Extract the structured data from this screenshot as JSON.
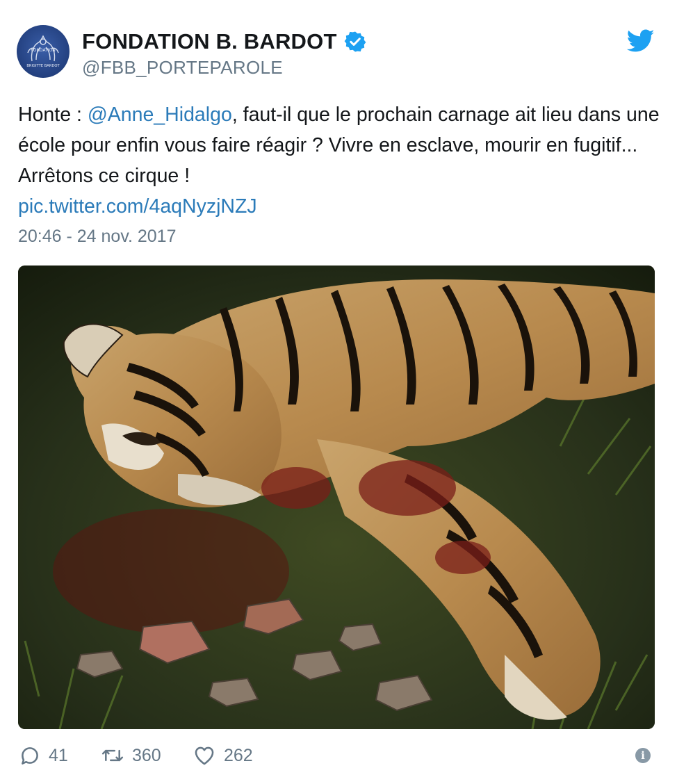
{
  "author": {
    "display_name": "FONDATION B. BARDOT",
    "handle": "@FBB_PORTEPAROLE",
    "verified": true,
    "avatar_icon": "foundation-logo-avatar",
    "avatar_text_top": "FONDATION",
    "avatar_text_bottom": "BRIGITTE BARDOT"
  },
  "brand_icon": "twitter-bird-icon",
  "tweet": {
    "text_prefix": "Honte : ",
    "mention": "@Anne_Hidalgo",
    "text_body": ", faut-il que le prochain carnage ait lieu dans une école pour enfin vous faire réagir ? Vivre en esclave, mourir en fugitif... Arrêtons ce cirque !",
    "link": "pic.twitter.com/4aqNyzjNZJ",
    "timestamp": "20:46 - 24 nov. 2017"
  },
  "media": {
    "type": "photo",
    "icon": "tiger-photo"
  },
  "actions": {
    "replies": "41",
    "retweets": "360",
    "likes": "262",
    "info_glyph": "i"
  },
  "colors": {
    "text": "#14171a",
    "secondary": "#657786",
    "link": "#2b7bb9",
    "verified": "#1da1f2",
    "twitter_blue": "#1da1f2"
  }
}
